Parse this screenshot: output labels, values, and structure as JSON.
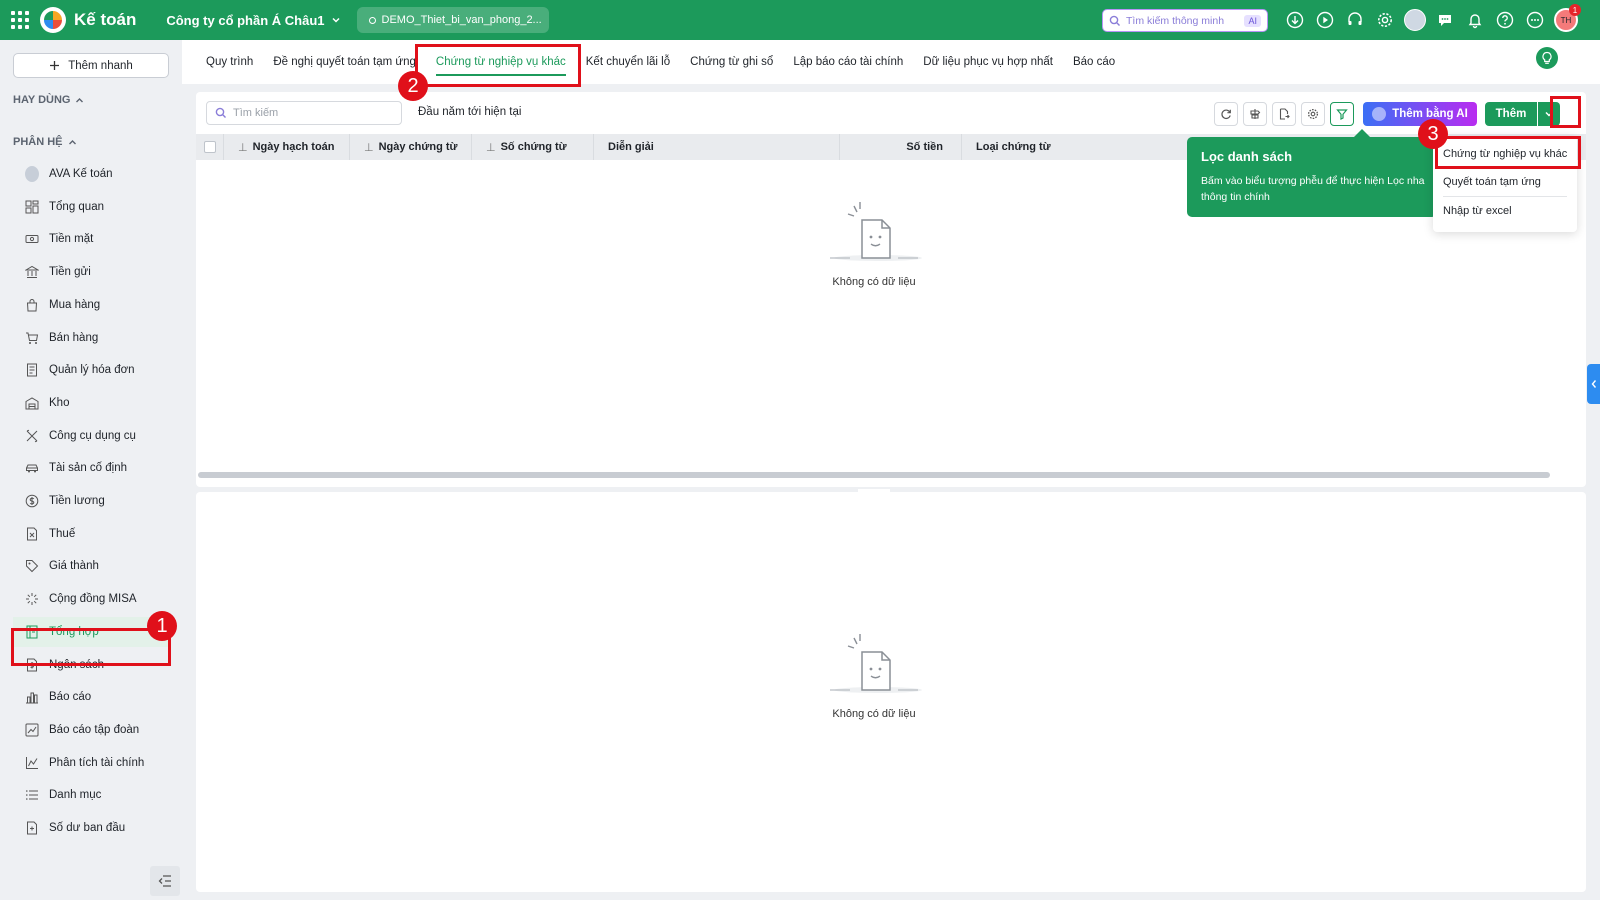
{
  "app": {
    "title": "Kế toán",
    "company": "Công ty cổ phần Á Châu1",
    "database": "DEMO_Thiet_bi_van_phong_2...",
    "smart_search_placeholder": "Tìm kiếm thông minh",
    "smart_search_ai": "AI",
    "notification_count": "1",
    "user_initials": "TH"
  },
  "sidebar": {
    "add_branch": "Thêm nhanh",
    "section_frequent": "HAY DÙNG",
    "section_modules": "PHÂN HỆ",
    "items": [
      {
        "label": "AVA Kế toán",
        "icon": "ava-avatar-icon"
      },
      {
        "label": "Tổng quan",
        "icon": "dashboard-icon"
      },
      {
        "label": "Tiền mặt",
        "icon": "cash-icon"
      },
      {
        "label": "Tiền gửi",
        "icon": "bank-icon"
      },
      {
        "label": "Mua hàng",
        "icon": "shopping-bag-icon"
      },
      {
        "label": "Bán hàng",
        "icon": "cart-icon"
      },
      {
        "label": "Quản lý hóa đơn",
        "icon": "invoice-icon"
      },
      {
        "label": "Kho",
        "icon": "warehouse-icon"
      },
      {
        "label": "Công cụ dụng cụ",
        "icon": "tools-icon"
      },
      {
        "label": "Tài sản cố định",
        "icon": "car-icon"
      },
      {
        "label": "Tiền lương",
        "icon": "salary-icon"
      },
      {
        "label": "Thuế",
        "icon": "tax-icon"
      },
      {
        "label": "Giá thành",
        "icon": "tag-icon"
      },
      {
        "label": "Cộng đồng MISA",
        "icon": "community-icon"
      },
      {
        "label": "Tổng hợp",
        "icon": "ledger-icon"
      },
      {
        "label": "Ngân sách",
        "icon": "budget-icon"
      },
      {
        "label": "Báo cáo",
        "icon": "bar-chart-icon"
      },
      {
        "label": "Báo cáo tập đoàn",
        "icon": "line-chart-icon"
      },
      {
        "label": "Phân tích tài chính",
        "icon": "analysis-icon"
      },
      {
        "label": "Danh mục",
        "icon": "list-icon"
      },
      {
        "label": "Số dư ban đầu",
        "icon": "opening-balance-icon"
      }
    ],
    "active_index": 14
  },
  "tabs": [
    {
      "label": "Quy trình"
    },
    {
      "label": "Đề nghị quyết toán tạm ứng"
    },
    {
      "label": "Chứng từ nghiệp vụ khác"
    },
    {
      "label": "Kết chuyển lãi lỗ"
    },
    {
      "label": "Chứng từ ghi sổ"
    },
    {
      "label": "Lập báo cáo tài chính"
    },
    {
      "label": "Dữ liệu phục vụ hợp nhất"
    },
    {
      "label": "Báo cáo"
    }
  ],
  "active_tab": 2,
  "toolbar": {
    "search_placeholder": "Tìm kiếm",
    "period": "Đầu năm tới hiện tại",
    "ai_add": "Thêm bằng AI",
    "add": "Thêm"
  },
  "table": {
    "columns": [
      "Ngày hạch toán",
      "Ngày chứng từ",
      "Số chứng từ",
      "Diễn giải",
      "Số tiền",
      "Loại chứng từ"
    ],
    "empty_text": "Không có dữ liệu"
  },
  "detail": {
    "empty_text": "Không có dữ liệu"
  },
  "tooltip": {
    "title": "Lọc danh sách",
    "text_line1": "Bấm vào biểu tượng phễu để thực hiện Lọc nha",
    "text_line2": "thông tin chính"
  },
  "dropdown": {
    "items": [
      "Chứng từ nghiệp vụ khác",
      "Quyết toán tạm ứng",
      "Nhập từ excel"
    ]
  },
  "annotations": {
    "step1": "1",
    "step2": "2",
    "step3": "3",
    "color": "#e0101a"
  },
  "colors": {
    "brand": "#1c9a5b",
    "ai_gradient_start": "#3b6ff5",
    "ai_gradient_end": "#b92cf0"
  }
}
